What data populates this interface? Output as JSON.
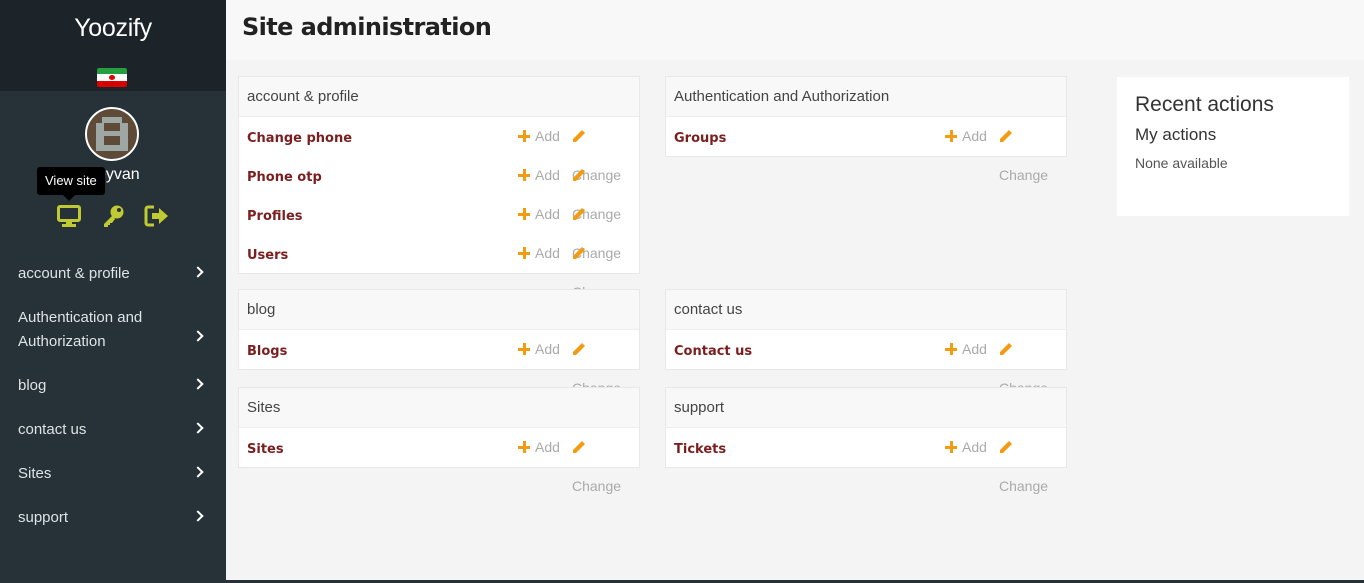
{
  "brand": {
    "name": "Yoozify"
  },
  "user": {
    "name": "Keyvan"
  },
  "tooltip": "View site",
  "user_tools": [
    {
      "icon": "monitor-icon",
      "label": "View site"
    },
    {
      "icon": "key-icon",
      "label": "Change password"
    },
    {
      "icon": "sign-out-icon",
      "label": "Log out"
    }
  ],
  "nav": [
    {
      "label": "account & profile"
    },
    {
      "label": "Authentication and Authorization"
    },
    {
      "label": "blog"
    },
    {
      "label": "contact us"
    },
    {
      "label": "Sites"
    },
    {
      "label": "support"
    }
  ],
  "header": {
    "title": "Site administration"
  },
  "actions": {
    "add": "Add",
    "change": "Change"
  },
  "modules": [
    {
      "title": "account & profile",
      "models": [
        "Change phone",
        "Phone otp",
        "Profiles",
        "Users"
      ]
    },
    {
      "title": "Authentication and Authorization",
      "models": [
        "Groups"
      ]
    },
    {
      "title": "blog",
      "models": [
        "Blogs"
      ]
    },
    {
      "title": "contact us",
      "models": [
        "Contact us"
      ]
    },
    {
      "title": "Sites",
      "models": [
        "Sites"
      ]
    },
    {
      "title": "support",
      "models": [
        "Tickets"
      ]
    }
  ],
  "recent": {
    "title": "Recent actions",
    "subtitle": "My actions",
    "empty": "None available"
  },
  "colors": {
    "sidebar": "#263238",
    "accent": "#c0ca33",
    "action": "#f39c12",
    "model_link": "#7a1f1f"
  }
}
